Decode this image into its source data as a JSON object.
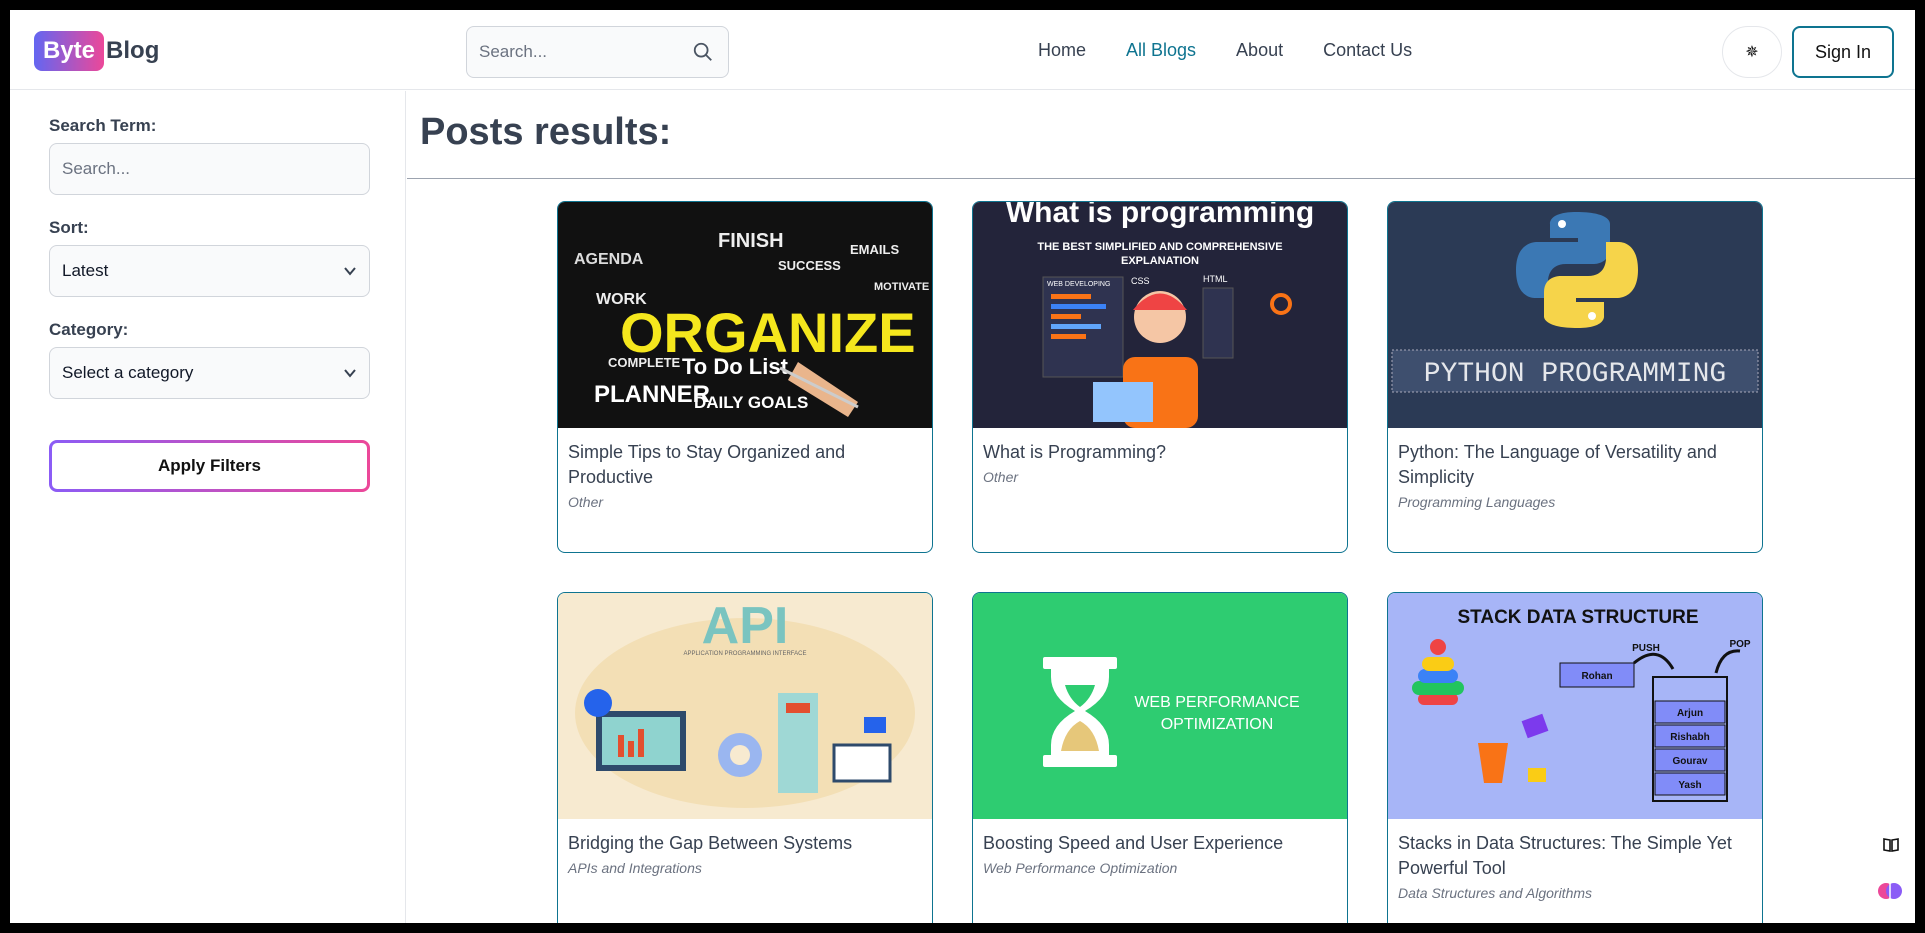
{
  "app": {
    "logo_badge": "Byte",
    "logo_rest": "Blog"
  },
  "header": {
    "search_placeholder": "Search...",
    "nav": [
      {
        "label": "Home",
        "active": false
      },
      {
        "label": "All Blogs",
        "active": true
      },
      {
        "label": "About",
        "active": false
      },
      {
        "label": "Contact Us",
        "active": false
      }
    ],
    "theme_icon": "✵",
    "signin_label": "Sign In"
  },
  "sidebar": {
    "search_label": "Search Term:",
    "search_placeholder": "Search...",
    "sort_label": "Sort:",
    "sort_value": "Latest",
    "category_label": "Category:",
    "category_value": "Select a category",
    "apply_label": "Apply Filters"
  },
  "main": {
    "title": "Posts results:",
    "posts": [
      {
        "title": "Simple Tips to Stay Organized and Productive",
        "category": "Other",
        "image": "organize-todo-list",
        "image_text": [
          "ORGANIZE",
          "To Do List",
          "PLANNER",
          "DAILY GOALS",
          "AGENDA",
          "WORK",
          "FINISH",
          "SUCCESS",
          "COMPLETE",
          "EMAILS",
          "MOTIVATE"
        ]
      },
      {
        "title": "What is Programming?",
        "category": "Other",
        "image": "what-is-programming",
        "image_text": [
          "What is programming",
          "THE BEST SIMPLIFIED AND COMPREHENSIVE",
          "EXPLANATION",
          "WEB DEVELOPING",
          "CSS",
          "HTML"
        ]
      },
      {
        "title": "Python: The Language of Versatility and Simplicity",
        "category": "Programming Languages",
        "image": "python-programming",
        "image_text": [
          "PYTHON PROGRAMMING"
        ]
      },
      {
        "title": "Bridging the Gap Between Systems",
        "category": "APIs and Integrations",
        "image": "api-illustration",
        "image_text": [
          "API",
          "APPLICATION PROGRAMMING INTERFACE"
        ]
      },
      {
        "title": "Boosting Speed and User Experience",
        "category": "Web Performance Optimization",
        "image": "web-performance-hourglass",
        "image_text": [
          "WEB PERFORMANCE",
          "OPTIMIZATION"
        ]
      },
      {
        "title": "Stacks in Data Structures: The Simple Yet Powerful Tool",
        "category": "Data Structures and Algorithms",
        "image": "stack-data-structure",
        "image_text": [
          "STACK DATA STRUCTURE",
          "PUSH",
          "POP",
          "Rohan",
          "Arjun",
          "Rishabh",
          "Gourav",
          "Yash"
        ]
      }
    ]
  },
  "colors": {
    "accent": "#0e7490",
    "logo_from": "#6366f1",
    "logo_to": "#ec4899"
  }
}
